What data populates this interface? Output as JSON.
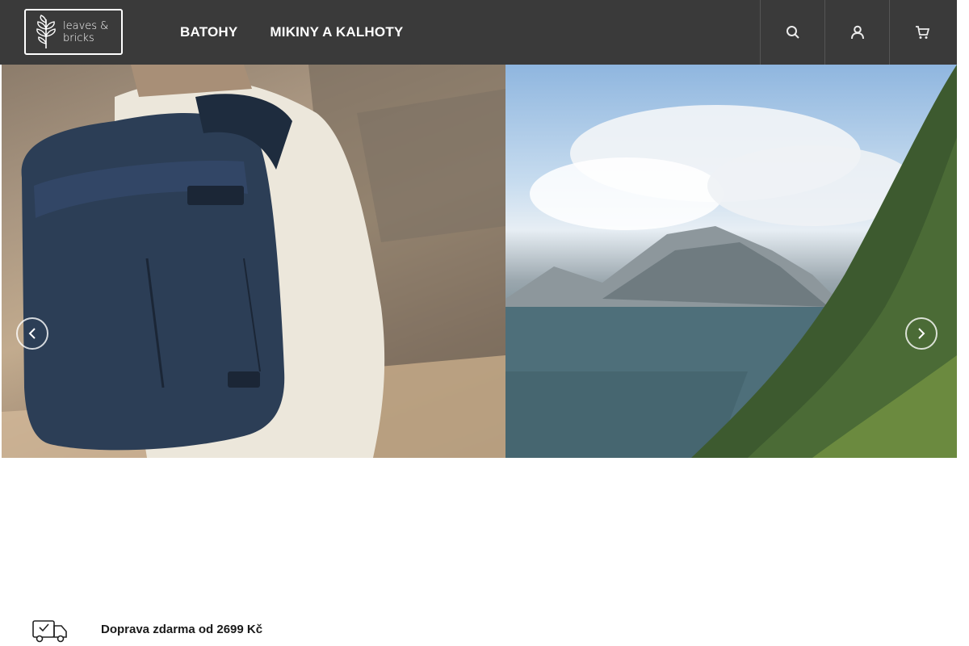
{
  "brand": {
    "logo_line1": "leaves &",
    "logo_line2": "bricks"
  },
  "nav": {
    "items": [
      {
        "label": "BATOHY"
      },
      {
        "label": "MIKINY A KALHOTY"
      }
    ]
  },
  "header_actions": [
    {
      "icon": "search-icon"
    },
    {
      "icon": "user-icon"
    },
    {
      "icon": "cart-icon"
    }
  ],
  "hero": {
    "slides": [
      {
        "image": "backpack-photo"
      },
      {
        "image": "mountain-lake-photo"
      }
    ]
  },
  "info_bar": {
    "shipping_label": "Doprava zdarma od 2699 Kč",
    "shipping_icon": "delivery-truck-icon"
  },
  "colors": {
    "header_bg": "#3a3a3a",
    "header_text": "#ffffff"
  }
}
